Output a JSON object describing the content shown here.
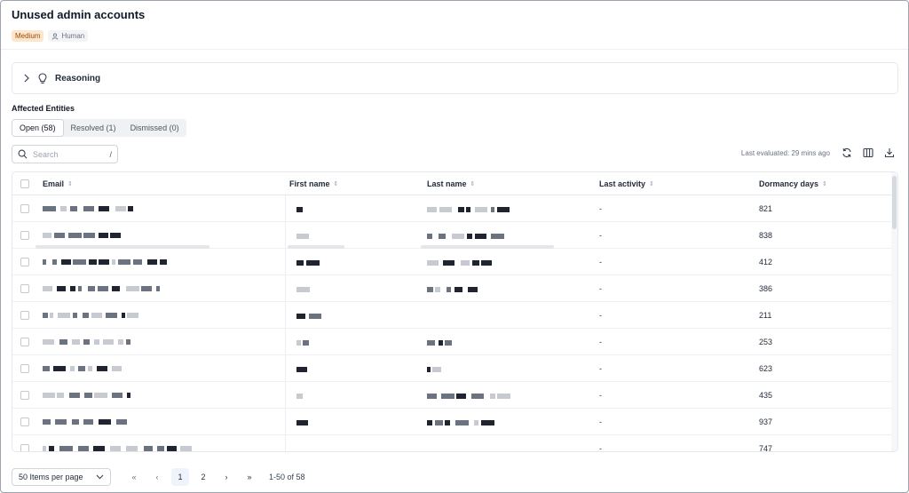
{
  "header": {
    "title": "Unused admin accounts",
    "severity": "Medium",
    "source": "Human"
  },
  "reasoning": {
    "label": "Reasoning"
  },
  "section": {
    "label": "Affected Entities"
  },
  "tabs": [
    {
      "label": "Open (58)",
      "active": true
    },
    {
      "label": "Resolved (1)",
      "active": false
    },
    {
      "label": "Dismissed (0)",
      "active": false
    }
  ],
  "search": {
    "placeholder": "Search",
    "shortcut": "/"
  },
  "toolbar": {
    "last_evaluated": "Last evaluated: 29 mins ago",
    "icons": [
      "refresh-icon",
      "columns-icon",
      "download-icon"
    ]
  },
  "table": {
    "columns": [
      "Email",
      "First name",
      "Last name",
      "Last activity",
      "Dormancy days"
    ],
    "rows": [
      {
        "last_activity": "-",
        "dormancy_days": "821"
      },
      {
        "last_activity": "-",
        "dormancy_days": "838"
      },
      {
        "last_activity": "-",
        "dormancy_days": "412"
      },
      {
        "last_activity": "-",
        "dormancy_days": "386"
      },
      {
        "last_activity": "-",
        "dormancy_days": "211"
      },
      {
        "last_activity": "-",
        "dormancy_days": "253"
      },
      {
        "last_activity": "-",
        "dormancy_days": "623"
      },
      {
        "last_activity": "-",
        "dormancy_days": "435"
      },
      {
        "last_activity": "-",
        "dormancy_days": "937"
      },
      {
        "last_activity": "-",
        "dormancy_days": "747"
      }
    ]
  },
  "pagination": {
    "per_page": "50 Items per page",
    "pages": [
      "1",
      "2"
    ],
    "current": "1",
    "range": "1-50 of 58"
  },
  "colors": {
    "severity_bg": "#fde7cc",
    "severity_text": "#9a4a10",
    "redaction": "#1f2430",
    "active_page_bg": "#eef4fb"
  }
}
